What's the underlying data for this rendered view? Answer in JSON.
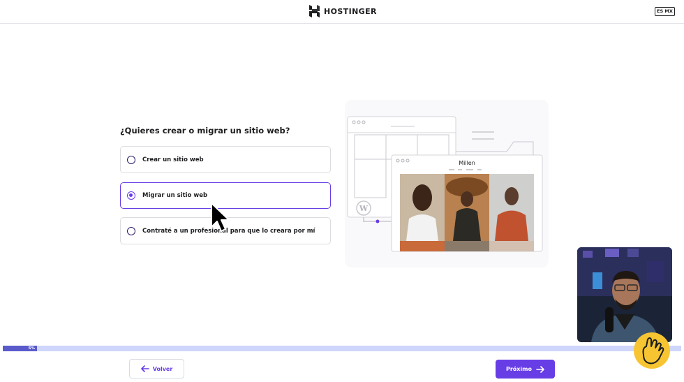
{
  "header": {
    "brand": "HOSTINGER",
    "language": "ES MX"
  },
  "question": "¿Quieres crear o migrar un sitio web?",
  "options": [
    {
      "label": "Crear un sitio web",
      "selected": false
    },
    {
      "label": "Migrar un sitio web",
      "selected": true
    },
    {
      "label": "Contraté a un profesional para que lo creara por mí",
      "selected": false
    }
  ],
  "illustration": {
    "site_title": "Millen"
  },
  "progress": {
    "label": "5%",
    "value": 0.05
  },
  "footer": {
    "back_label": "Volver",
    "next_label": "Próximo"
  },
  "colors": {
    "accent": "#673de6",
    "progress_track": "#cfd6fb",
    "progress_fill": "#5a5acb"
  },
  "icons": [
    "hostinger-logo-icon",
    "radio-icon",
    "arrow-left-icon",
    "arrow-right-icon",
    "wordpress-icon",
    "mouse-cursor-icon",
    "pointing-hand-icon"
  ]
}
